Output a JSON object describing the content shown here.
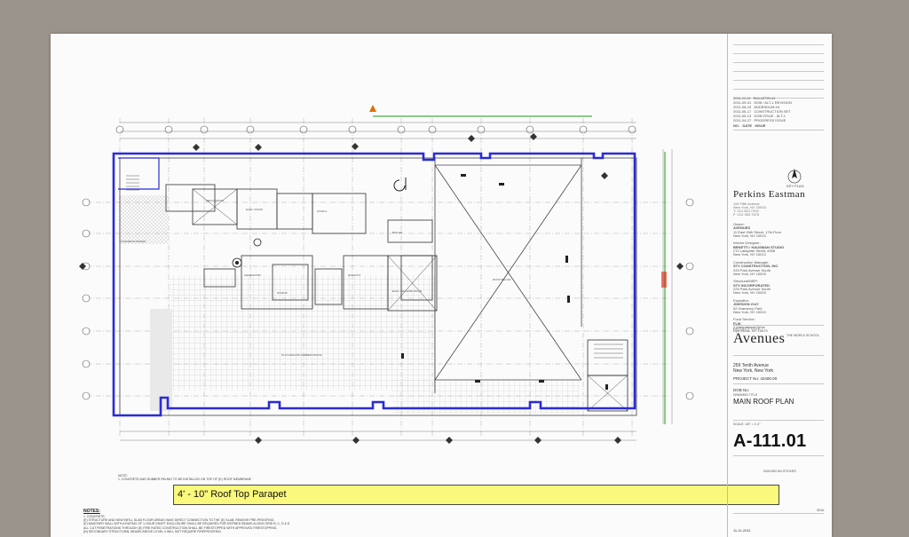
{
  "title_block": {
    "firm_name": "Perkins Eastman",
    "revisions": [
      {
        "mark": "",
        "date": "2011-11-11",
        "desc": "BULLETIN #1"
      },
      {
        "mark": "",
        "date": "2011-09-01",
        "desc": "DOB / ALT-1 REVISION"
      },
      {
        "mark": "",
        "date": "2011-08-15",
        "desc": "ADDENDUM #3"
      },
      {
        "mark": "",
        "date": "2011-06-17",
        "desc": "CONSTRUCTION SET"
      },
      {
        "mark": "",
        "date": "2011-05-13",
        "desc": "DOB ISSUE - ALT-1"
      },
      {
        "mark": "",
        "date": "2011-04-27",
        "desc": "PROGRESS ISSUE"
      },
      {
        "mark": "NO.",
        "date": "DATE",
        "desc": "ISSUE"
      }
    ],
    "project_title": "Avenues",
    "project_subtitle": "THE WORLD SCHOOL",
    "address_line1": "259 Tenth Avenue",
    "address_line2": "New York, New York",
    "project_no": "PROJECT No: 42400.00",
    "dob_no": "DOB No:",
    "drawing_title_label": "DRAWING TITLE",
    "drawing_title": "MAIN ROOF PLAN",
    "scale": "SCALE:  1/8\" = 1'-0\"",
    "sheet_no": "A-111.01",
    "stamp_label": "DOB BSCAN STICKER",
    "deal_label": "SEAL",
    "date": "11-11-2011",
    "north_label": "KEY PLAN"
  },
  "callout": {
    "text": "4' - 10\" Roof Top Parapet"
  },
  "notes": {
    "heading": "NOTES:",
    "top_note": "NOTE:\n1. CONCRETE AND RUBBER PAVING TO BE INSTALLED ON TOP OF (E) ROOF MEMBRANE",
    "lines": [
      "1. CONCRETE:",
      "   (E) STRUCTURE AND NEW INFILL SLAB FLOOR AREAS HAVE DIRECT CONNECTION TO THE (E) SLAB, REMOVE PRE-PROOFING.",
      "   (E) MASONRY WALL WITH A RATING OF 1-HOUR SHAFT ENCLOSURE SHALL BE REQUIRED FOR DEFINED BEAMS ALONG GRID B, C, D & E.",
      "   ALL CUT PENETRATIONS THROUGH (E) FIRE RATED CONSTRUCTION SHALL BE FIRESTOPPED WITH APPROVED FIRESTOPPING.",
      "   (N) SECONDARY STRUCTURAL BEAMS ABOVE LEVEL 4 WILL NOT REQUIRE FIREPROOFING."
    ]
  },
  "room_labels": [
    "CONCRETE PAVERS",
    "MECH. ROOM",
    "ELEC. ROOM",
    "STAIR A",
    "STAIR B",
    "ELEV. MACHINE ROOM",
    "ROOF BELOW",
    "RUBBER PAVERS",
    "MECH. EQUIP.",
    "GENERATOR",
    "EXHAUST",
    "BOILER",
    "TOILET",
    "PLAYGROUND RUBBER PAVING"
  ],
  "colors": {
    "parapet_line": "#2b2bd6",
    "callout_fill": "#fbf97b",
    "dimension_green": "#1a9a1a",
    "background": "#9b948c",
    "sheet": "#fbfbfb"
  }
}
